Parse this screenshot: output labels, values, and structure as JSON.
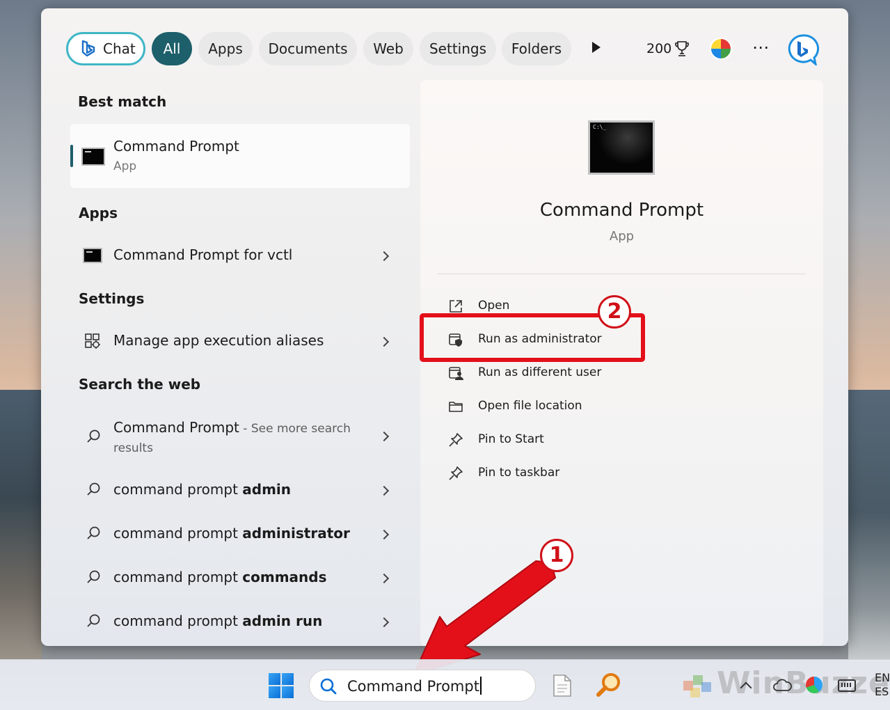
{
  "filters": {
    "chat": "Chat",
    "all": "All",
    "apps": "Apps",
    "documents": "Documents",
    "web": "Web",
    "settings": "Settings",
    "folders": "Folders",
    "points": "200"
  },
  "best_match": {
    "heading": "Best match",
    "title": "Command Prompt",
    "subtitle": "App"
  },
  "apps_section": {
    "heading": "Apps",
    "items": [
      {
        "name": "Command Prompt",
        "suffix": " for vctl"
      }
    ]
  },
  "settings_section": {
    "heading": "Settings",
    "items": [
      {
        "label": "Manage app execution aliases"
      }
    ]
  },
  "web_section": {
    "heading": "Search the web",
    "first": {
      "title": "Command Prompt",
      "see_more": " - See more search",
      "see_more_2": "results"
    },
    "items": [
      {
        "prefix": "command prompt ",
        "bold": "admin"
      },
      {
        "prefix": "command prompt ",
        "bold": "administrator"
      },
      {
        "prefix": "command prompt ",
        "bold": "commands"
      },
      {
        "prefix": "command prompt ",
        "bold": "admin run"
      }
    ]
  },
  "preview": {
    "icon_text": "C:\\_",
    "title": "Command Prompt",
    "subtitle": "App",
    "actions": [
      {
        "label": "Open",
        "icon": "open-external-icon"
      },
      {
        "label": "Run as administrator",
        "icon": "shield-admin-icon"
      },
      {
        "label": "Run as different user",
        "icon": "user-switch-icon"
      },
      {
        "label": "Open file location",
        "icon": "folder-icon"
      },
      {
        "label": "Pin to Start",
        "icon": "pin-icon"
      },
      {
        "label": "Pin to taskbar",
        "icon": "pin-icon"
      }
    ]
  },
  "annotations": {
    "step1": "1",
    "step2": "2"
  },
  "taskbar": {
    "search_value": "Command Prompt",
    "watermark": "WinBuzzer",
    "lang_line1": "EN",
    "lang_line2": "ES"
  },
  "colors": {
    "accent": "#1d5f6a",
    "chat_border": "#3fb6c6",
    "highlight": "#e3101a"
  }
}
